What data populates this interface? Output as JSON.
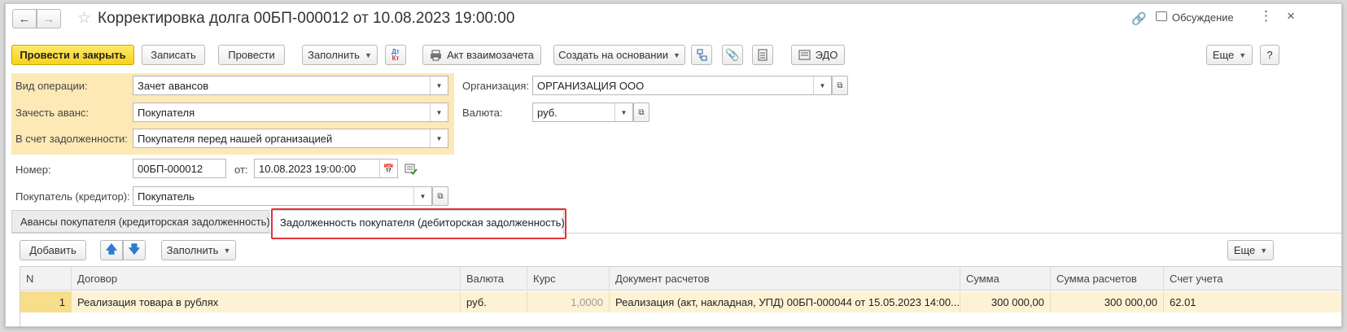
{
  "header": {
    "title": "Корректировка долга 00БП-000012 от 10.08.2023 19:00:00",
    "discussion_label": "Обсуждение"
  },
  "toolbar": {
    "post_and_close": "Провести и закрыть",
    "save": "Записать",
    "post": "Провести",
    "fill": "Заполнить",
    "dtkt_top": "Дт",
    "dtkt_bottom": "Кт",
    "reconciliation_act": "Акт взаимозачета",
    "create_based_on": "Создать на основании",
    "edo": "ЭДО",
    "more": "Еще",
    "help": "?"
  },
  "form": {
    "operation_type_label": "Вид операции:",
    "operation_type_value": "Зачет авансов",
    "offset_advance_label": "Зачесть аванс:",
    "offset_advance_value": "Покупателя",
    "on_account_label": "В счет задолженности:",
    "on_account_value": "Покупателя перед нашей организацией",
    "organization_label": "Организация:",
    "organization_value": "ОРГАНИЗАЦИЯ ООО",
    "currency_label": "Валюта:",
    "currency_value": "руб.",
    "number_label": "Номер:",
    "number_value": "00БП-000012",
    "date_label": "от:",
    "date_value": "10.08.2023 19:00:00",
    "buyer_label": "Покупатель (кредитор):",
    "buyer_value": "Покупатель"
  },
  "tabs": [
    {
      "label": "Авансы покупателя (кредиторская задолженность)",
      "active": false
    },
    {
      "label": "Задолженность покупателя (дебиторская задолженность)",
      "active": true
    }
  ],
  "table_toolbar": {
    "add": "Добавить",
    "fill": "Заполнить",
    "more": "Еще"
  },
  "table": {
    "columns": [
      "N",
      "Договор",
      "Валюта",
      "Курс",
      "Документ расчетов",
      "Сумма",
      "Сумма расчетов",
      "Счет учета"
    ],
    "rows": [
      [
        "1",
        "Реализация товара в рублях",
        "руб.",
        "1,0000",
        "Реализация (акт, накладная, УПД) 00БП-000044 от 15.05.2023 14:00...",
        "300 000,00",
        "300 000,00",
        "62.01"
      ]
    ]
  },
  "colors": {
    "primary_button": "#f7d21c",
    "highlight_area": "#fce9b6",
    "selected_row": "#fdf3d4",
    "tab_callout": "#e0353a",
    "arrow_blue": "#2b7cd3"
  }
}
